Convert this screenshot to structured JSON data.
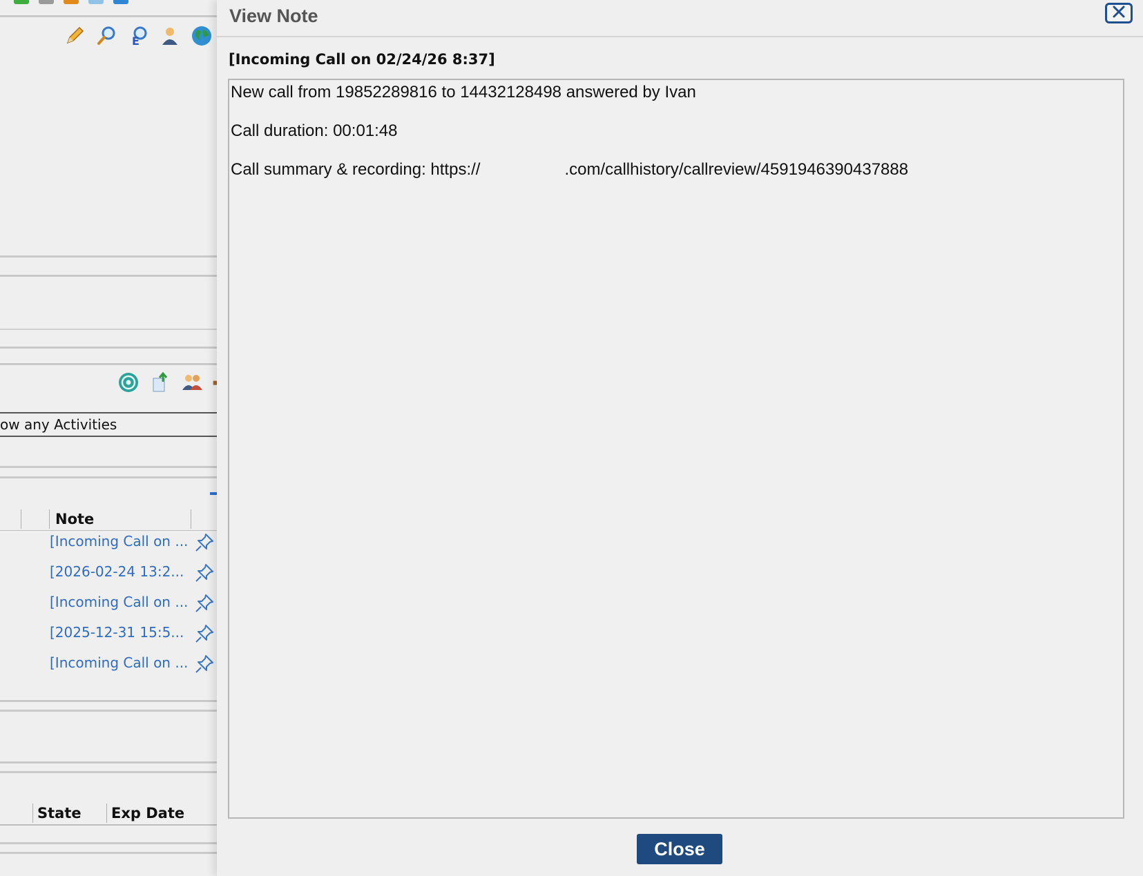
{
  "background": {
    "filter_value": "ow any Activities",
    "notes_grid": {
      "column_header": "Note",
      "rows": [
        {
          "text": "[Incoming Call on ..."
        },
        {
          "text": "[2026-02-24 13:2..."
        },
        {
          "text": "[Incoming Call on ..."
        },
        {
          "text": "[2025-12-31 15:5..."
        },
        {
          "text": "[Incoming Call on ..."
        }
      ]
    },
    "lower_grid": {
      "col_state": "State",
      "col_exp_date": "Exp Date"
    },
    "toolbar_icons": [
      "pencil-icon",
      "magnifier-icon",
      "zoom-e-icon",
      "contact-icon",
      "globe-icon"
    ],
    "activity_icons": [
      "target-icon",
      "upload-doc-icon",
      "people-icon",
      "briefcase-icon"
    ]
  },
  "dialog": {
    "title": "View Note",
    "note_heading": "[Incoming Call on 02/24/26 8:37]",
    "lines": {
      "call_from": "New call from 19852289816 to 14432128498 answered by Ivan",
      "duration": "Call duration: 00:01:48",
      "summary_prefix": "Call summary & recording: https://",
      "summary_suffix": ".com/callhistory/callreview/4591946390437888"
    },
    "close_label": "Close"
  },
  "colors": {
    "link": "#2f6cc0",
    "button_bg": "#1f4a7f",
    "close_x_border": "#1f4f8f"
  }
}
